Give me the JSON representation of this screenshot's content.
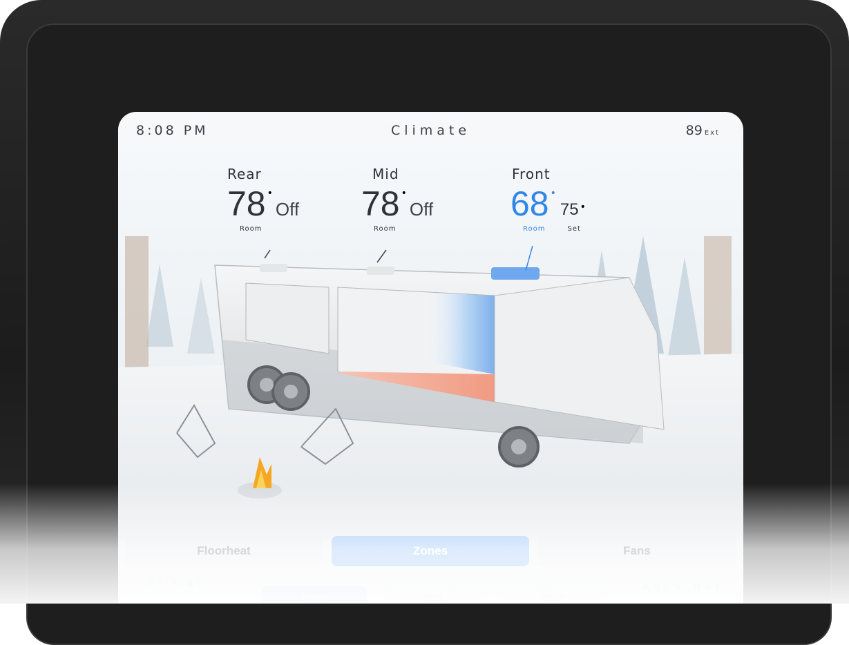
{
  "status_bar": {
    "time": "8:08 PM",
    "title": "Climate",
    "ext_temp": "89",
    "ext_label": "Ext"
  },
  "zones": [
    {
      "name": "Rear",
      "temp": "78",
      "status": "Off",
      "room_label": "Room"
    },
    {
      "name": "Mid",
      "temp": "78",
      "status": "Off",
      "room_label": "Room"
    },
    {
      "name": "Front",
      "temp": "68",
      "set_temp": "75",
      "room_label": "Room",
      "set_label": "Set"
    }
  ],
  "tabs": [
    {
      "label": "Floorheat",
      "active": false
    },
    {
      "label": "Zones",
      "active": true
    },
    {
      "label": "Fans",
      "active": false
    }
  ],
  "sub": {
    "left_label": "Climate",
    "right_label": "Aqua-Hot",
    "buttons": [
      "Front",
      "Mid",
      "Rear"
    ]
  },
  "colors": {
    "accent_blue": "#2f86e8",
    "tab_active": "#6aa6f2",
    "heat_floor": "#f2a48f"
  }
}
